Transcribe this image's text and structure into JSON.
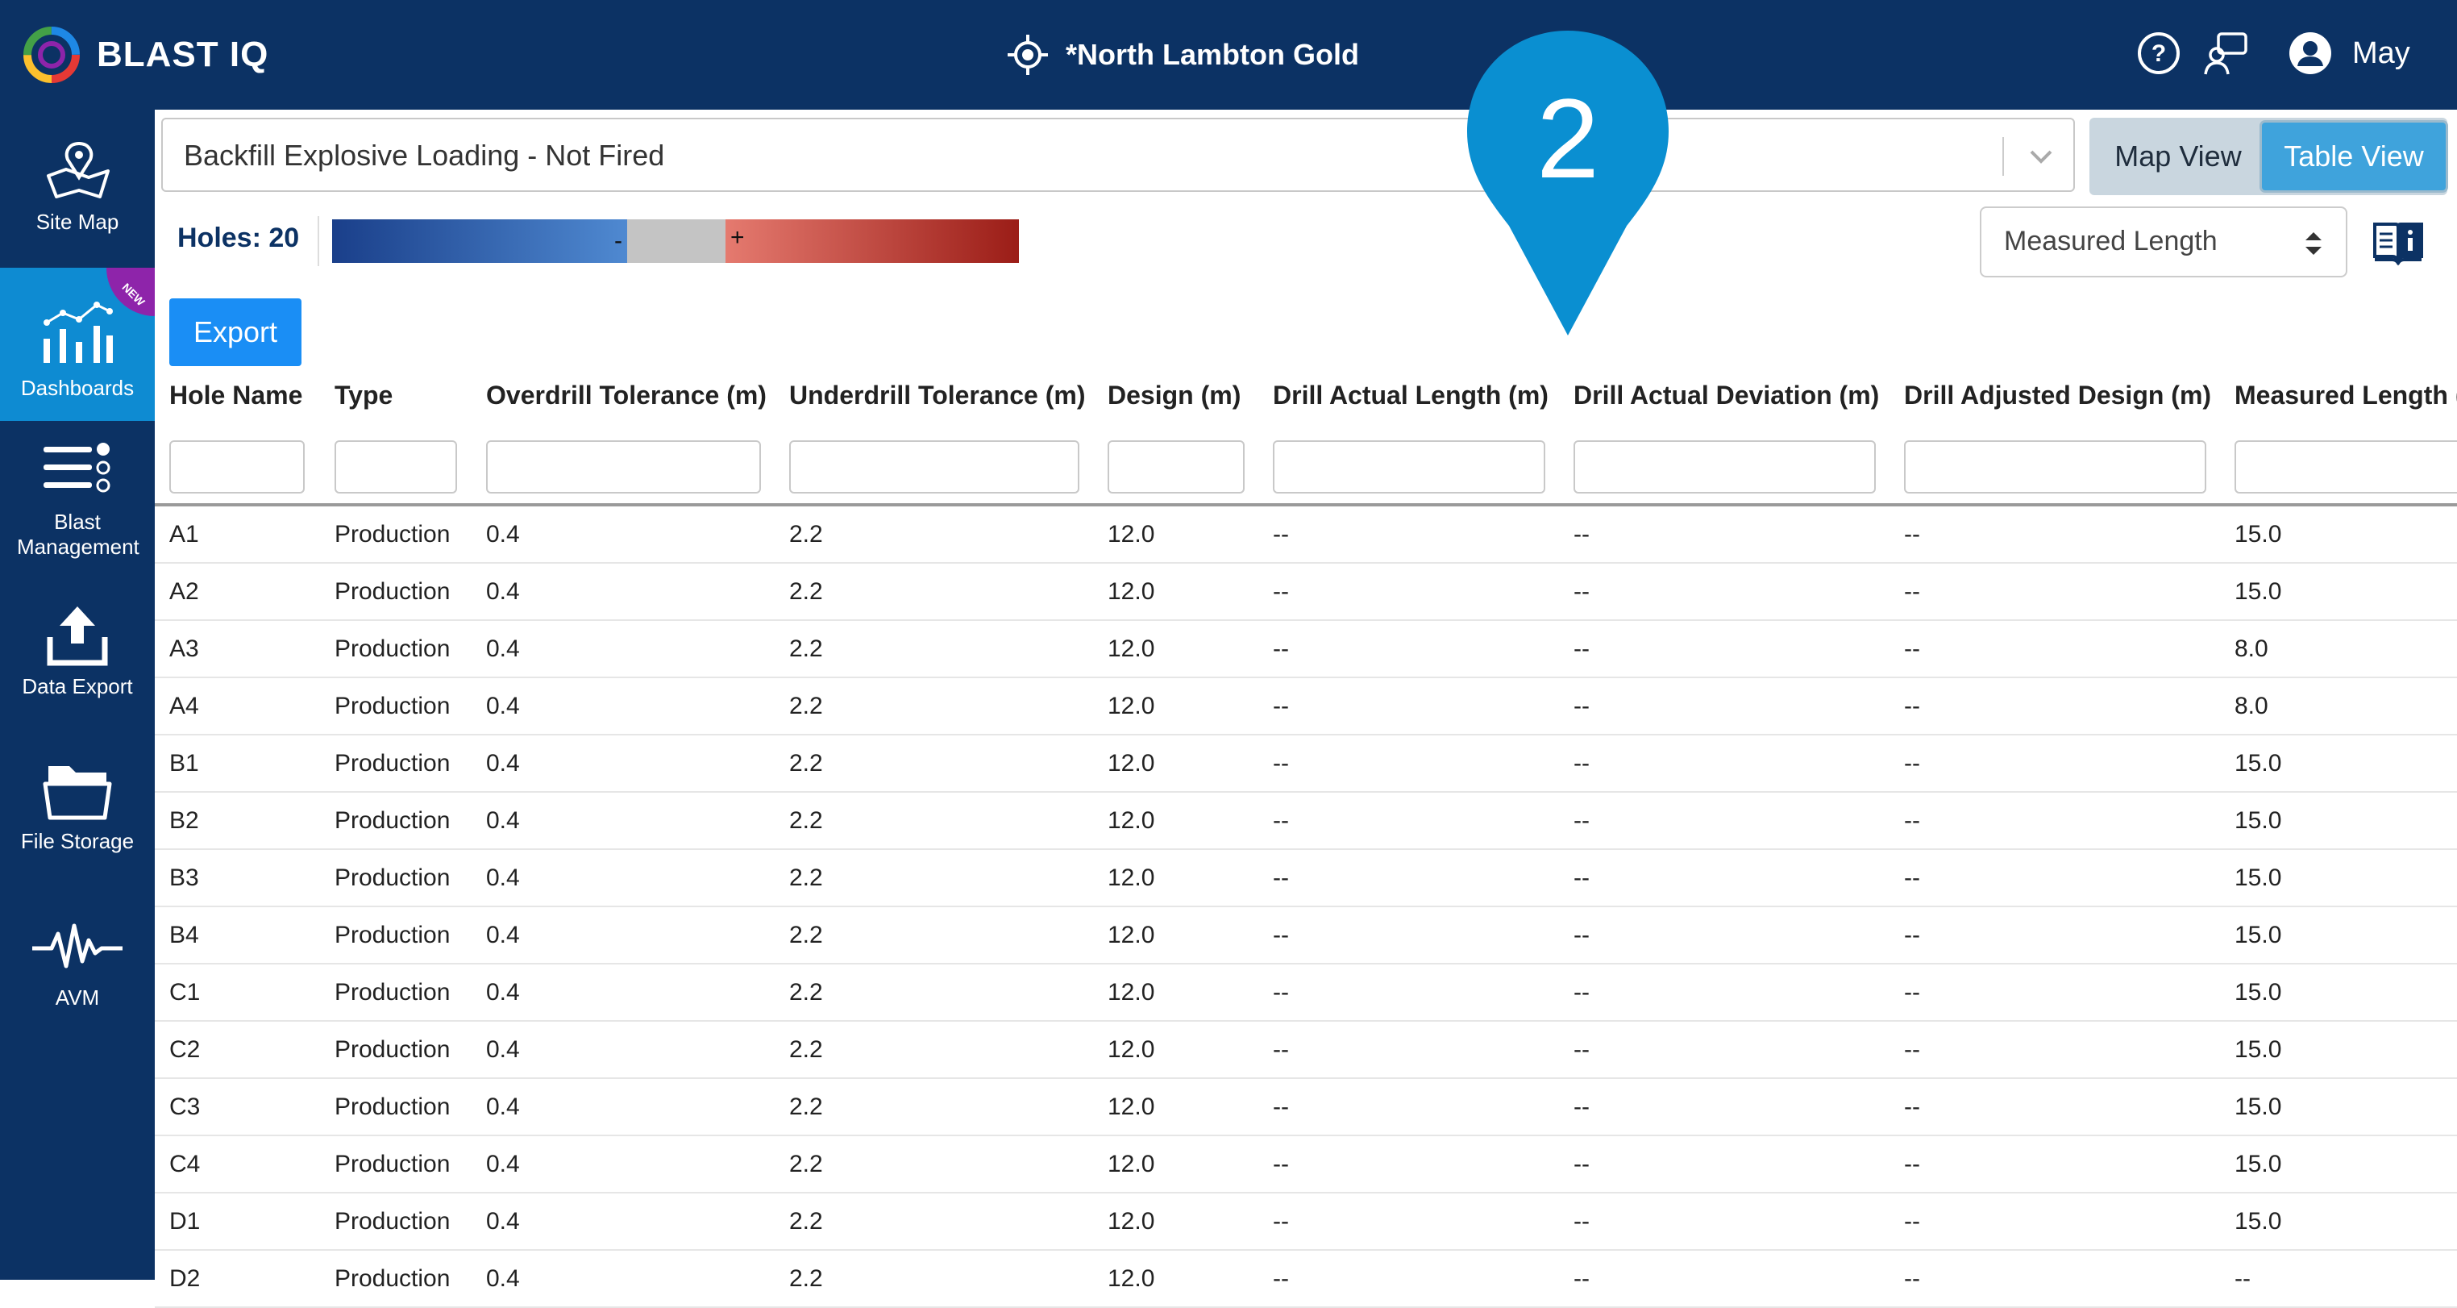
{
  "brand": {
    "name": "BLAST IQ"
  },
  "header": {
    "site_name": "*North Lambton Gold",
    "user_name": "May"
  },
  "sidebar": {
    "items": [
      {
        "label": "Site Map",
        "icon": "map-icon"
      },
      {
        "label": "Dashboards",
        "icon": "dashboard-icon",
        "badge": "NEW",
        "active": true
      },
      {
        "label": "Blast Management",
        "icon": "list-icon"
      },
      {
        "label": "Data Export",
        "icon": "upload-icon"
      },
      {
        "label": "File Storage",
        "icon": "folder-icon"
      },
      {
        "label": "AVM",
        "icon": "waveform-icon"
      }
    ]
  },
  "blast_select": {
    "value": "Backfill Explosive Loading - Not Fired"
  },
  "view_toggle": {
    "map_label": "Map View",
    "table_label": "Table View",
    "active": "Table View"
  },
  "holes": {
    "label": "Holes: 20"
  },
  "legend": {
    "minus": "-",
    "plus": "+",
    "colors": {
      "low": "#1a3f8a",
      "mid": "#c4c4c4",
      "high": "#9b1d17"
    }
  },
  "measure_select": {
    "value": "Measured Length"
  },
  "export": {
    "label": "Export"
  },
  "pin": {
    "number": "2",
    "color": "#0a8fd1"
  },
  "table": {
    "columns": [
      "Hole Name",
      "Type",
      "Overdrill Tolerance (m)",
      "Underdrill Tolerance (m)",
      "Design (m)",
      "Drill Actual Length (m)",
      "Drill Actual Deviation (m)",
      "Drill Adjusted Design (m)",
      "Measured Length (m"
    ],
    "rows": [
      [
        "A1",
        "Production",
        "0.4",
        "2.2",
        "12.0",
        "--",
        "--",
        "--",
        "15.0"
      ],
      [
        "A2",
        "Production",
        "0.4",
        "2.2",
        "12.0",
        "--",
        "--",
        "--",
        "15.0"
      ],
      [
        "A3",
        "Production",
        "0.4",
        "2.2",
        "12.0",
        "--",
        "--",
        "--",
        "8.0"
      ],
      [
        "A4",
        "Production",
        "0.4",
        "2.2",
        "12.0",
        "--",
        "--",
        "--",
        "8.0"
      ],
      [
        "B1",
        "Production",
        "0.4",
        "2.2",
        "12.0",
        "--",
        "--",
        "--",
        "15.0"
      ],
      [
        "B2",
        "Production",
        "0.4",
        "2.2",
        "12.0",
        "--",
        "--",
        "--",
        "15.0"
      ],
      [
        "B3",
        "Production",
        "0.4",
        "2.2",
        "12.0",
        "--",
        "--",
        "--",
        "15.0"
      ],
      [
        "B4",
        "Production",
        "0.4",
        "2.2",
        "12.0",
        "--",
        "--",
        "--",
        "15.0"
      ],
      [
        "C1",
        "Production",
        "0.4",
        "2.2",
        "12.0",
        "--",
        "--",
        "--",
        "15.0"
      ],
      [
        "C2",
        "Production",
        "0.4",
        "2.2",
        "12.0",
        "--",
        "--",
        "--",
        "15.0"
      ],
      [
        "C3",
        "Production",
        "0.4",
        "2.2",
        "12.0",
        "--",
        "--",
        "--",
        "15.0"
      ],
      [
        "C4",
        "Production",
        "0.4",
        "2.2",
        "12.0",
        "--",
        "--",
        "--",
        "15.0"
      ],
      [
        "D1",
        "Production",
        "0.4",
        "2.2",
        "12.0",
        "--",
        "--",
        "--",
        "15.0"
      ],
      [
        "D2",
        "Production",
        "0.4",
        "2.2",
        "12.0",
        "--",
        "--",
        "--",
        "--"
      ]
    ]
  },
  "colors": {
    "navy": "#0c3264",
    "accent": "#0e8bd2",
    "export": "#1a8ef5",
    "badge": "#8e24aa"
  }
}
